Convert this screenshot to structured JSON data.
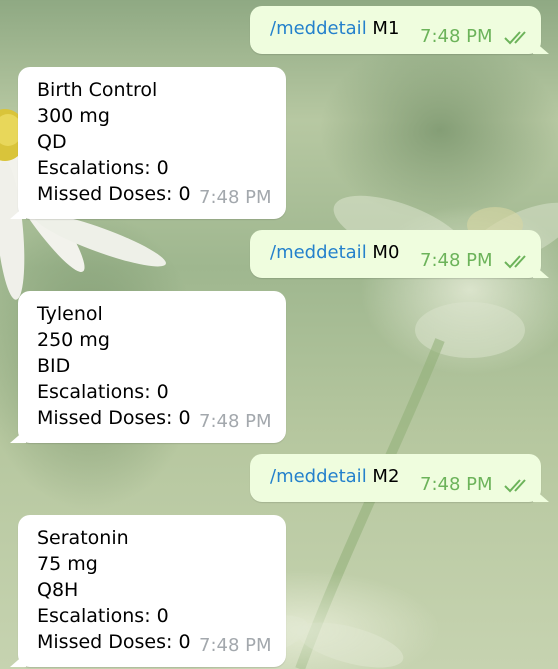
{
  "colors": {
    "outgoing_bubble": "#effdde",
    "incoming_bubble": "#ffffff",
    "command_link": "#2481cc",
    "outgoing_time": "#6cb35a",
    "incoming_time": "#a3a8ad"
  },
  "messages": [
    {
      "type": "outgoing",
      "command": "/meddetail",
      "arg": " M1",
      "time": "7:48 PM",
      "status_icon": "double-check-icon"
    },
    {
      "type": "incoming",
      "lines": [
        "Birth Control",
        "300 mg",
        "QD",
        "Escalations: 0",
        "Missed Doses: 0"
      ],
      "time": "7:48 PM"
    },
    {
      "type": "outgoing",
      "command": "/meddetail",
      "arg": " M0",
      "time": "7:48 PM",
      "status_icon": "double-check-icon"
    },
    {
      "type": "incoming",
      "lines": [
        "Tylenol",
        "250 mg",
        "BID",
        "Escalations: 0",
        "Missed Doses: 0"
      ],
      "time": "7:48 PM"
    },
    {
      "type": "outgoing",
      "command": "/meddetail",
      "arg": " M2",
      "time": "7:48 PM",
      "status_icon": "double-check-icon"
    },
    {
      "type": "incoming",
      "lines": [
        "Seratonin",
        "75 mg",
        "Q8H",
        "Escalations: 0",
        "Missed Doses: 0"
      ],
      "time": "7:48 PM"
    }
  ]
}
